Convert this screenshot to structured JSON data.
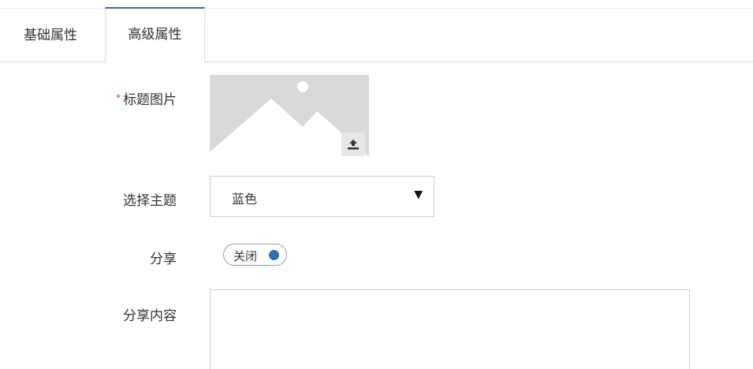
{
  "tabs": [
    {
      "label": "基础属性",
      "active": false
    },
    {
      "label": "高级属性",
      "active": true
    }
  ],
  "form": {
    "title_image": {
      "label": "标题图片",
      "required_mark": "*",
      "icon": "image-placeholder-icon",
      "upload_icon": "upload-icon"
    },
    "theme": {
      "label": "选择主题",
      "selected": "蓝色",
      "arrow": "▼"
    },
    "share": {
      "label": "分享",
      "toggle_text": "关闭",
      "toggle_on": false
    },
    "share_content": {
      "label": "分享内容",
      "value": ""
    }
  },
  "colors": {
    "active_tab_border": "#3b6aa0",
    "required_star": "#e0453a",
    "toggle_knob": "#2f6db5",
    "image_bg": "#d9d9d9"
  }
}
